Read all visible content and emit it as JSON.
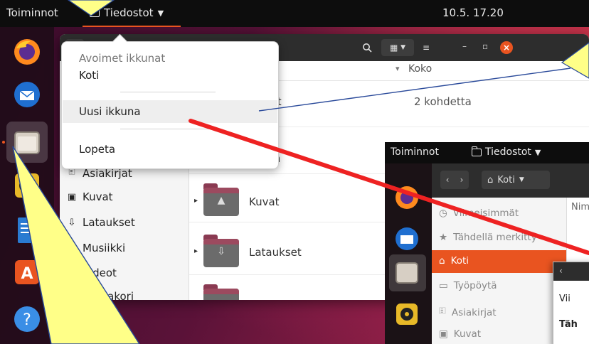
{
  "topbar": {
    "activities": "Toiminnot",
    "app_menu": "Tiedostot",
    "clock": "10.5.  17.20"
  },
  "window": {
    "column_headers": {
      "size": "Koko"
    },
    "rows": [
      {
        "name": "Asiakirjat",
        "name_partial": "irjat",
        "size": "2 kohdetta"
      },
      {
        "name_partial": "nen"
      },
      {
        "name": "Kuvat"
      },
      {
        "name": "Lataukset"
      }
    ]
  },
  "sidebar": {
    "items": [
      {
        "label": "Asiakirjat",
        "icon": "document-icon"
      },
      {
        "label": "Kuvat",
        "icon": "image-icon"
      },
      {
        "label": "Lataukset",
        "icon": "download-icon"
      },
      {
        "label": "Musiikki",
        "icon": "music-icon"
      },
      {
        "label": "Videot",
        "icon": "video-icon"
      },
      {
        "label": "Roskakori",
        "icon": "trash-icon"
      }
    ]
  },
  "popover": {
    "section_title": "Avoimet ikkunat",
    "items": [
      "Koti",
      "Uusi ikkuna",
      "Lopeta"
    ]
  },
  "inset": {
    "topbar": {
      "activities": "Toiminnot",
      "app_menu": "Tiedostot"
    },
    "location": "Koti",
    "column_header_partial": "Nim",
    "sidebar": [
      {
        "label": "Viimeisimmät",
        "icon": "clock-icon"
      },
      {
        "label": "Tähdellä merkitty",
        "icon": "star-icon"
      },
      {
        "label": "Koti",
        "icon": "home-icon"
      },
      {
        "label": "Työpöytä",
        "icon": "desktop-icon"
      },
      {
        "label": "Asiakirjat",
        "icon": "document-icon"
      },
      {
        "label": "Kuvat",
        "icon": "image-icon"
      }
    ],
    "popup_items": [
      "Vii",
      "Täh"
    ]
  },
  "colors": {
    "accent": "#e95420",
    "annotation_fill": "#ffff88",
    "annotation_line": "#2a4a9a",
    "arrow": "#ee2222"
  }
}
